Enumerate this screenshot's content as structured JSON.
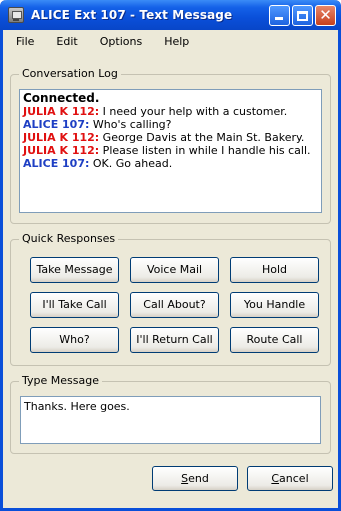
{
  "window": {
    "title": "ALICE Ext 107 - Text Message"
  },
  "menu": {
    "items": [
      "File",
      "Edit",
      "Options",
      "Help"
    ]
  },
  "conversation_log": {
    "label": "Conversation Log",
    "status": "Connected.",
    "messages": [
      {
        "speaker": "JULIA K 112:",
        "text": " I need your help with a customer.",
        "color": "#e01010"
      },
      {
        "speaker": "ALICE 107:",
        "text": " Who's calling?",
        "color": "#1e3fc4"
      },
      {
        "speaker": "JULIA K 112:",
        "text": " George Davis at the Main St. Bakery.",
        "color": "#e01010"
      },
      {
        "speaker": "JULIA K 112:",
        "text": " Please listen in while I handle his call.",
        "color": "#e01010"
      },
      {
        "speaker": "ALICE 107:",
        "text": " OK. Go ahead.",
        "color": "#1e3fc4"
      }
    ]
  },
  "quick_responses": {
    "label": "Quick Responses",
    "buttons": [
      "Take Message",
      "Voice Mail",
      "Hold",
      "I'll Take Call",
      "Call About?",
      "You Handle",
      "Who?",
      "I'll Return Call",
      "Route Call"
    ]
  },
  "type_message": {
    "label": "Type Message",
    "value": "Thanks. Here goes."
  },
  "actions": {
    "send": {
      "mnemonic": "S",
      "rest": "end"
    },
    "cancel": {
      "mnemonic": "C",
      "rest": "ancel"
    }
  },
  "colors": {
    "titlebar": "#0a4fd9",
    "julia": "#e01010",
    "alice": "#1e3fc4",
    "window_bg": "#ece9d8"
  }
}
